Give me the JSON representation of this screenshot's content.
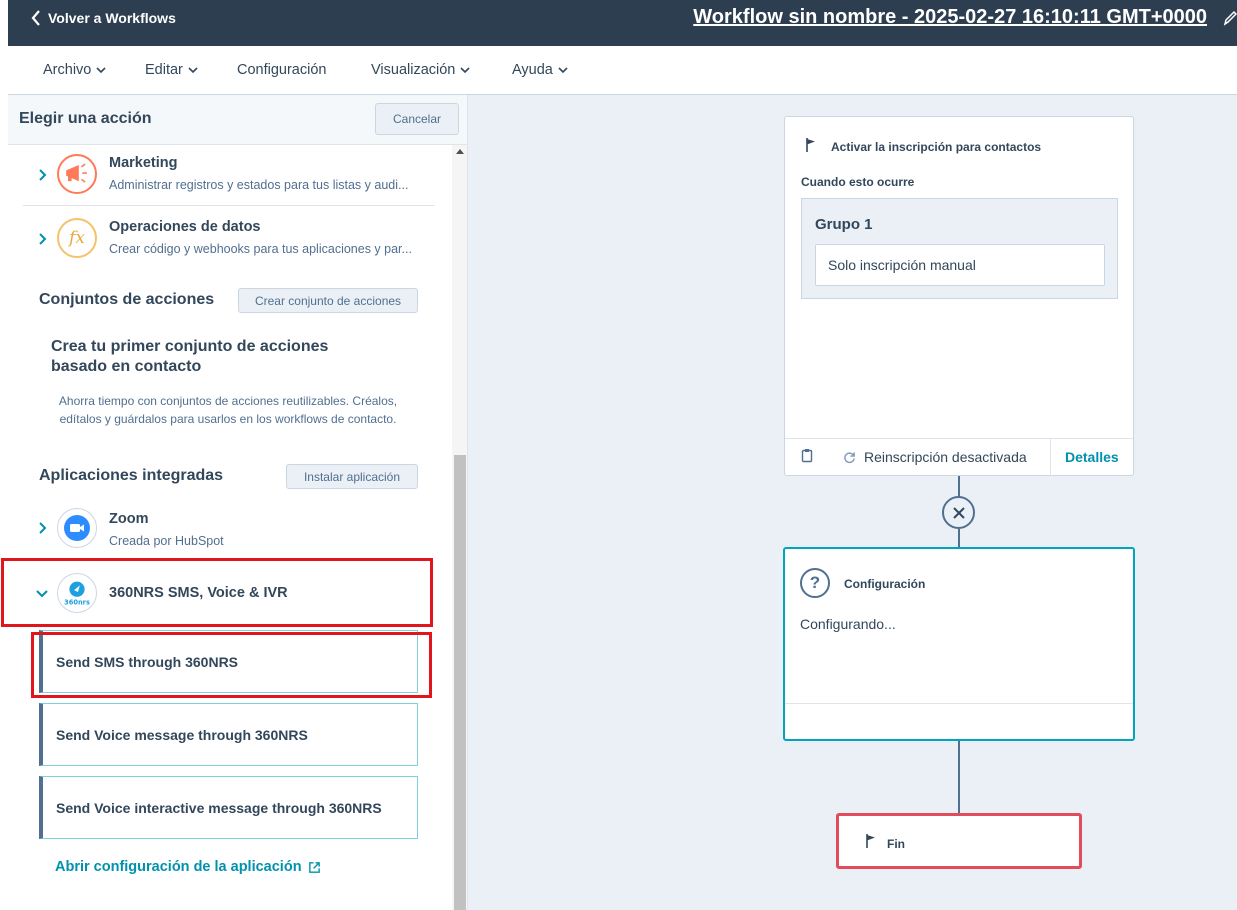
{
  "topbar": {
    "back_label": "Volver a Workflows",
    "workflow_title": "Workflow sin nombre - 2025-02-27 16:10:11 GMT+0000"
  },
  "menu": {
    "items": [
      "Archivo",
      "Editar",
      "Configuración",
      "Visualización",
      "Ayuda"
    ]
  },
  "panel": {
    "title": "Elegir una acción",
    "cancel_label": "Cancelar",
    "categories": [
      {
        "name": "Marketing",
        "description": "Administrar registros y estados para tus listas y audi...",
        "icon": "megaphone-icon"
      },
      {
        "name": "Operaciones de datos",
        "description": "Crear código y webhooks para tus aplicaciones y par...",
        "icon": "function-icon"
      }
    ],
    "action_sets": {
      "title": "Conjuntos de acciones",
      "create_label": "Crear conjunto de acciones",
      "empty_title": "Crea tu primer conjunto de acciones basado en contacto",
      "empty_description": "Ahorra tiempo con conjuntos de acciones reutilizables. Créalos, edítalos y guárdalos para usarlos en los workflows de contacto."
    },
    "integrated_apps": {
      "title": "Aplicaciones integradas",
      "install_label": "Instalar aplicación",
      "apps": [
        {
          "name": "Zoom",
          "subtitle": "Creada por HubSpot",
          "icon": "video-camera-icon"
        },
        {
          "name": "360NRS SMS, Voice & IVR",
          "icon": "360nrs-logo-icon",
          "logo_text": "360nrs"
        }
      ],
      "actions": [
        "Send SMS through 360NRS",
        "Send Voice message through 360NRS",
        "Send Voice interactive message through 360NRS"
      ],
      "settings_link": "Abrir configuración de la aplicación"
    }
  },
  "canvas": {
    "trigger": {
      "heading": "Activar la inscripción para contactos",
      "subheading": "Cuando esto ocurre",
      "group_title": "Grupo 1",
      "group_value": "Solo inscripción manual",
      "reenrollment": "Reinscripción desactivada",
      "details_label": "Detalles"
    },
    "config": {
      "title": "Configuración",
      "status": "Configurando..."
    },
    "end": {
      "label": "Fin"
    }
  },
  "colors": {
    "topbar": "#2d3e50",
    "accent": "#00a4bd",
    "link": "#0091ae",
    "highlight": "#e0161c"
  }
}
